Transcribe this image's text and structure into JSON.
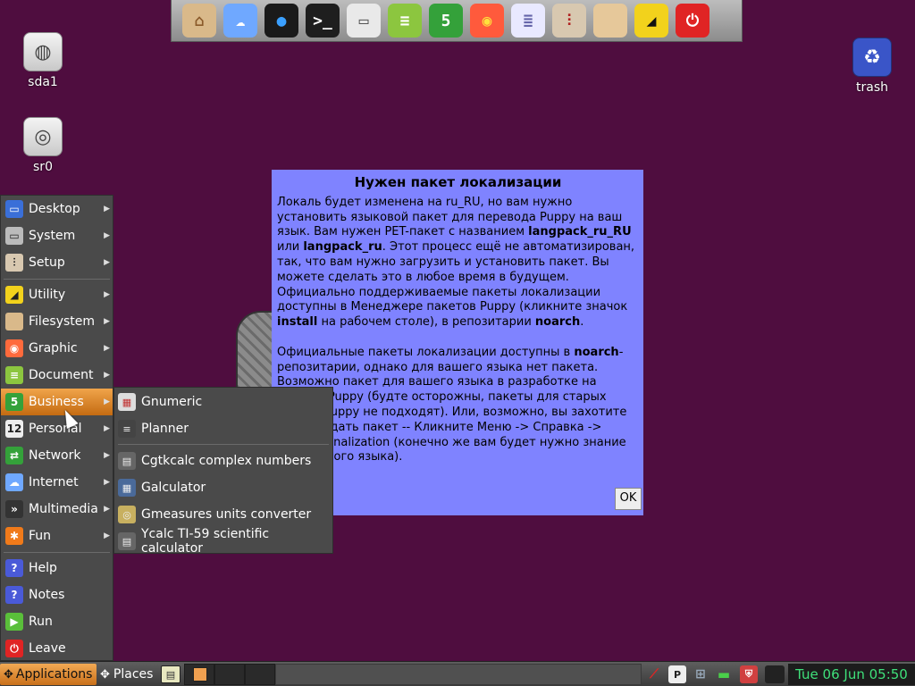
{
  "dock": {
    "items": [
      {
        "name": "home-icon",
        "glyph": "⌂",
        "bg": "#d9b98a",
        "fg": "#8a5a2a"
      },
      {
        "name": "cloud-icon",
        "glyph": "☁",
        "bg": "#6fa8ff",
        "fg": "#ffffff"
      },
      {
        "name": "chat-icon",
        "glyph": "●",
        "bg": "#1a1a1a",
        "fg": "#3aa0ff"
      },
      {
        "name": "terminal-icon",
        "glyph": ">_",
        "bg": "#1e1e1e",
        "fg": "#ffffff"
      },
      {
        "name": "monitor-icon",
        "glyph": "▭",
        "bg": "#e9e9e9",
        "fg": "#555555"
      },
      {
        "name": "document-icon",
        "glyph": "≡",
        "bg": "#8cc63f",
        "fg": "#ffffff"
      },
      {
        "name": "spreadsheet-icon",
        "glyph": "5",
        "bg": "#34a13a",
        "fg": "#ffffff"
      },
      {
        "name": "color-wheel-icon",
        "glyph": "◉",
        "bg": "#ff5a3c",
        "fg": "#ffe23c"
      },
      {
        "name": "text-editor-icon",
        "glyph": "≣",
        "bg": "#e9e9ff",
        "fg": "#6666aa"
      },
      {
        "name": "settings-sliders-icon",
        "glyph": "⫶",
        "bg": "#d8c8b0",
        "fg": "#b02020"
      },
      {
        "name": "folder-icon",
        "glyph": "",
        "bg": "#e6c89a",
        "fg": "#a07a40"
      },
      {
        "name": "utility-icon",
        "glyph": "◢",
        "bg": "#f2d21c",
        "fg": "#111111"
      },
      {
        "name": "power-icon",
        "glyph": "⏻",
        "bg": "#e02424",
        "fg": "#ffffff"
      }
    ]
  },
  "desktop": {
    "sda1": "sda1",
    "sr0": "sr0",
    "trash": "trash"
  },
  "dialog": {
    "title": "Нужен пакет локализации",
    "p1_a": "Локаль будет изменена на ru_RU, но вам нужно установить языковой пакет для перевода Puppy на ваш язык. Вам нужен PET-пакет с названием ",
    "p1_b1": "langpack_ru_RU",
    "p1_c": " или ",
    "p1_b2": "langpack_ru",
    "p1_d": ". Этот процесс ещё не автоматизирован, так, что вам нужно загрузить и установить пакет. Вы можете сделать это в любое время в будущем. Официально поддерживаемые пакеты локализации доступны в Менеджере пакетов Puppy (кликните значок ",
    "p1_b3": "install",
    "p1_e": " на рабочем столе), в репозитарии ",
    "p1_b4": "noarch",
    "p1_f": ".",
    "p2_a": "Официальные пакеты локализации доступны в ",
    "p2_b1": "noarch",
    "p2_c": "-репозитарии, однако для вашего языка нет пакета. Возможно пакет для вашего языка в разработке на форуме Puppy (будте осторожны, пакеты для старых версий Puppy не подходят). Или, возможно, вы захотите сами создать пакет -- Кликните Меню -> Справка -> Internationalization (конечно же вам будет нужно знание английского языка).",
    "ok_label": "OK"
  },
  "menu": {
    "items": [
      {
        "key": "desktop",
        "label": "Desktop",
        "icon": "desktop-icon",
        "glyph": "▭",
        "bg": "#3a6fd8",
        "arrow": true
      },
      {
        "key": "system",
        "label": "System",
        "icon": "system-icon",
        "glyph": "▭",
        "bg": "#bbbbbb",
        "arrow": true
      },
      {
        "key": "setup",
        "label": "Setup",
        "icon": "setup-icon",
        "glyph": "⫶",
        "bg": "#d8c8b0",
        "arrow": true
      },
      {
        "key": "utility",
        "label": "Utility",
        "icon": "utility-icon",
        "glyph": "◢",
        "bg": "#f2d21c",
        "arrow": true
      },
      {
        "key": "filesystem",
        "label": "Filesystem",
        "icon": "folder-icon",
        "glyph": "",
        "bg": "#d9b98a",
        "arrow": true
      },
      {
        "key": "graphic",
        "label": "Graphic",
        "icon": "color-wheel-icon",
        "glyph": "◉",
        "bg": "#ff6a3c",
        "arrow": true
      },
      {
        "key": "document",
        "label": "Document",
        "icon": "document-icon",
        "glyph": "≡",
        "bg": "#8cc63f",
        "arrow": true
      },
      {
        "key": "business",
        "label": "Business",
        "icon": "spreadsheet-icon",
        "glyph": "5",
        "bg": "#34a13a",
        "arrow": true
      },
      {
        "key": "personal",
        "label": "Personal",
        "icon": "calendar-icon",
        "glyph": "12",
        "bg": "#eeeeee",
        "arrow": true
      },
      {
        "key": "network",
        "label": "Network",
        "icon": "network-icon",
        "glyph": "⇄",
        "bg": "#34a13a",
        "arrow": true
      },
      {
        "key": "internet",
        "label": "Internet",
        "icon": "cloud-icon",
        "glyph": "☁",
        "bg": "#6fa8ff",
        "arrow": true
      },
      {
        "key": "multimedia",
        "label": "Multimedia",
        "icon": "multimedia-icon",
        "glyph": "»",
        "bg": "#333333",
        "arrow": true
      },
      {
        "key": "fun",
        "label": "Fun",
        "icon": "puzzle-icon",
        "glyph": "✱",
        "bg": "#f07a1a",
        "arrow": true
      },
      {
        "key": "help",
        "label": "Help",
        "icon": "help-icon",
        "glyph": "?",
        "bg": "#4a5ad8",
        "arrow": false
      },
      {
        "key": "notes",
        "label": "Notes",
        "icon": "notes-icon",
        "glyph": "?",
        "bg": "#4a5ad8",
        "arrow": false
      },
      {
        "key": "run",
        "label": "Run",
        "icon": "run-icon",
        "glyph": "▶",
        "bg": "#5abf3a",
        "arrow": false
      },
      {
        "key": "leave",
        "label": "Leave",
        "icon": "power-icon",
        "glyph": "⏻",
        "bg": "#e02424",
        "arrow": false
      }
    ]
  },
  "submenu": {
    "items": [
      {
        "label": "Gnumeric",
        "icon": "gnumeric-icon",
        "glyph": "▦",
        "bg": "#dddddd"
      },
      {
        "label": "Planner",
        "icon": "planner-icon",
        "glyph": "≡",
        "bg": "#444444"
      },
      {
        "label": "Cgtkcalc complex numbers",
        "icon": "calculator-icon",
        "glyph": "▤",
        "bg": "#666666"
      },
      {
        "label": "Galculator",
        "icon": "galculator-icon",
        "glyph": "▦",
        "bg": "#4a6a9a"
      },
      {
        "label": "Gmeasures units converter",
        "icon": "converter-icon",
        "glyph": "◎",
        "bg": "#c8b060"
      },
      {
        "label": "Ycalc TI-59 scientific calculator",
        "icon": "calculator-icon",
        "glyph": "▤",
        "bg": "#666666"
      }
    ]
  },
  "taskbar": {
    "applications_label": "Applications",
    "places_label": "Places",
    "clock": "Tue 06 Jun 05:50"
  }
}
